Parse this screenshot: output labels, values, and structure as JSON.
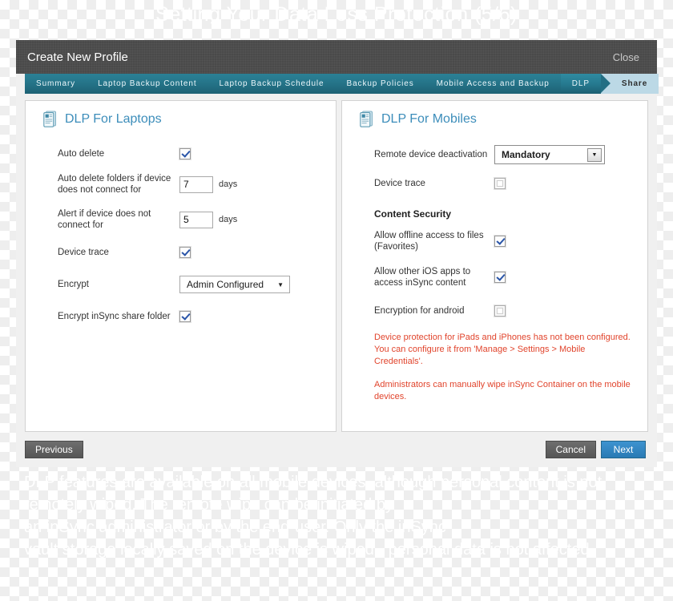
{
  "watermark": {
    "top": "Setting Your Data Loss Protection (5/6)",
    "bottom": "DLP features are available on all mobile devices, although personal content is not\nremotely wiped. The remote wipe can be initiated by\nan inSync administrator or by the end-user. Only the inSync\nvault storage locally saved on the device is wiped - personal data is not affected."
  },
  "titlebar": {
    "title": "Create New Profile",
    "close_label": "Close"
  },
  "tabs": [
    {
      "label": "Summary",
      "state": "done"
    },
    {
      "label": "Laptop Backup Content",
      "state": "done"
    },
    {
      "label": "Laptop Backup Schedule",
      "state": "done"
    },
    {
      "label": "Backup Policies",
      "state": "done"
    },
    {
      "label": "Mobile Access and Backup",
      "state": "done"
    },
    {
      "label": "DLP",
      "state": "active"
    },
    {
      "label": "Share",
      "state": "future"
    }
  ],
  "left_panel": {
    "heading": "DLP For Laptops",
    "rows": {
      "auto_delete": {
        "label": "Auto delete",
        "checked": true
      },
      "auto_delete_folders": {
        "label": "Auto delete folders if device does not connect for",
        "value": "7",
        "unit": "days"
      },
      "alert_if": {
        "label": "Alert if device does not connect for",
        "value": "5",
        "unit": "days"
      },
      "device_trace": {
        "label": "Device trace",
        "checked": true
      },
      "encrypt": {
        "label": "Encrypt",
        "value": "Admin Configured"
      },
      "encrypt_share": {
        "label": "Encrypt inSync share folder",
        "checked": true
      }
    }
  },
  "right_panel": {
    "heading": "DLP For Mobiles",
    "rows": {
      "remote_deactivation": {
        "label": "Remote device deactivation",
        "value": "Mandatory"
      },
      "device_trace": {
        "label": "Device trace",
        "checked": false
      }
    },
    "content_security": {
      "title": "Content Security",
      "rows": {
        "offline_access": {
          "label": "Allow offline access to files (Favorites)",
          "checked": true
        },
        "other_ios_apps": {
          "label": "Allow other iOS apps to access inSync content",
          "checked": true
        },
        "encryption_android": {
          "label": "Encryption for android",
          "checked": false
        }
      }
    },
    "notices": [
      "Device protection for iPads and iPhones has not been configured. You can configure it from 'Manage > Settings > Mobile Credentials'.",
      "Administrators can manually wipe inSync Container on the mobile devices."
    ]
  },
  "footer": {
    "previous_label": "Previous",
    "cancel_label": "Cancel",
    "next_label": "Next"
  },
  "colors": {
    "accent_teal": "#26768b",
    "heading_blue": "#3c8dba",
    "notice_red": "#e1442c",
    "primary_button_blue": "#2a7ab4"
  }
}
